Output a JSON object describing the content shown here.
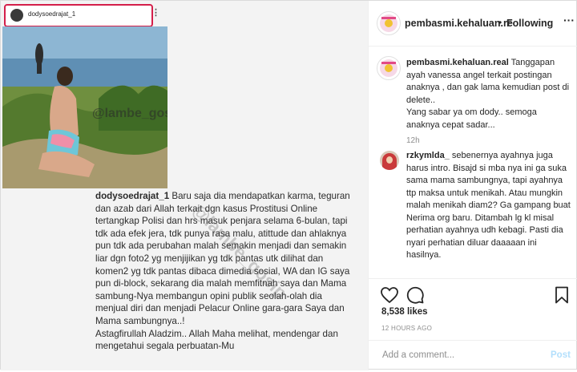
{
  "media": {
    "shot_username": "dodysoedrajat_1",
    "shot_more": "⋮",
    "photo_watermark": "@lambe_gosip",
    "caption_username": "dodysoedrajat_1",
    "caption_text": "Baru saja dia mendapatkan karma, teguran dan azab dari Allah terkait dgn kasus Prostitusi Online tertangkap Polisi dan hrs masuk penjara selama 6-bulan, tapi tdk ada efek jera, tdk punya rasa malu, atittude dan ahlaknya pun tdk ada perubahan malah semakin menjadi dan semakin liar dgn foto2 yg menjijikan yg tdk pantas utk dilihat dan komen2 yg tdk pantas dibaca dimedia sosial, WA dan IG saya pun di-block, sekarang dia malah memfitnah saya dan Mama sambung-Nya membangun opini publik seolah-olah dia menjual diri dan menjadi Pelacur Online gara-gara Saya dan Mama sambungnya..!",
    "caption_text2": "Astagfirullah Aladzim.. Allah Maha melihat, mendengar dan mengetahui segala perbuatan-Mu",
    "diag_watermark": "@lambe_gosip"
  },
  "header": {
    "username": "pembasmi.kehaluan.re",
    "separator": "•",
    "follow_status": "Following",
    "more": "···"
  },
  "comments": [
    {
      "username": "pembasmi.kehaluan.real",
      "text": "Tanggapan ayah vanessa angel terkait postingan anaknya , dan gak lama kemudian post di delete..",
      "text2": "Yang sabar ya om dody.. semoga anaknya cepat sadar...",
      "time": "12h"
    },
    {
      "username": "rzkymlda_",
      "text": "sebenernya ayahnya juga harus intro. Bisajd si mba nya ini ga suka sama mama sambungnya, tapi ayahnya ttp maksa untuk menikah. Atau mungkin malah menikah diam2? Ga gampang buat Nerima org baru. Ditambah lg kl misal perhatian ayahnya udh kebagi. Pasti dia nyari perhatian diluar daaaaan ini hasilnya."
    }
  ],
  "actions": {
    "likes": "8,538 likes",
    "ago": "12 HOURS AGO",
    "comment_placeholder": "Add a comment...",
    "post_label": "Post"
  },
  "colors": {
    "highlight_border": "#d41f4a",
    "post_button": "#b2dffc",
    "secondary_text": "#8e8e8e"
  },
  "icons": [
    "heart-icon",
    "comment-icon",
    "bookmark-icon",
    "more-icon"
  ]
}
